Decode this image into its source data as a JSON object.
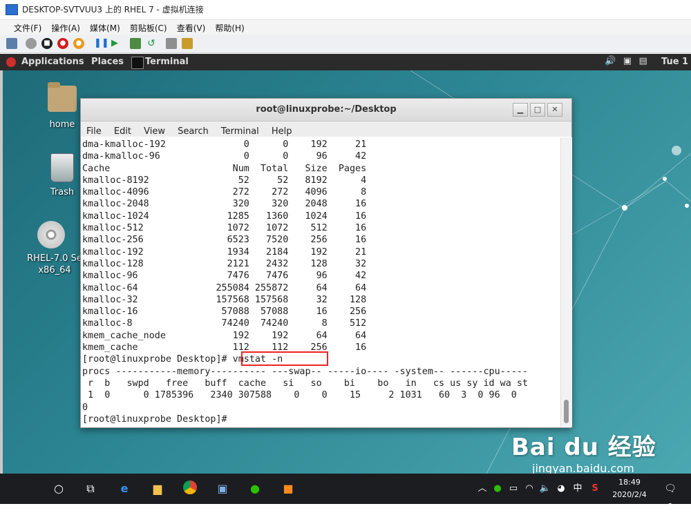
{
  "host_window": {
    "title": "DESKTOP-SVTVUU3 上的 RHEL 7 - 虚拟机连接",
    "menu": [
      "文件(F)",
      "操作(A)",
      "媒体(M)",
      "剪贴板(C)",
      "查看(V)",
      "帮助(H)"
    ]
  },
  "gnome_bar": {
    "applications": "Applications",
    "places": "Places",
    "active_app": "Terminal",
    "clock": "Tue 1"
  },
  "desktop_icons": [
    {
      "label": "home"
    },
    {
      "label": "Trash"
    },
    {
      "label": "RHEL-7.0 Se x86_64"
    }
  ],
  "terminal": {
    "title": "root@linuxprobe:~/Desktop",
    "menu": [
      "File",
      "Edit",
      "View",
      "Search",
      "Terminal",
      "Help"
    ],
    "lines": [
      "dma-kmalloc-192              0      0    192     21",
      "dma-kmalloc-96               0      0     96     42",
      "Cache                      Num  Total   Size  Pages",
      "kmalloc-8192                52     52   8192      4",
      "kmalloc-4096               272    272   4096      8",
      "kmalloc-2048               320    320   2048     16",
      "kmalloc-1024              1285   1360   1024     16",
      "kmalloc-512               1072   1072    512     16",
      "kmalloc-256               6523   7520    256     16",
      "kmalloc-192               1934   2184    192     21",
      "kmalloc-128               2121   2432    128     32",
      "kmalloc-96                7476   7476     96     42",
      "kmalloc-64              255084 255872     64     64",
      "kmalloc-32              157568 157568     32    128",
      "kmalloc-16               57088  57088     16    256",
      "kmalloc-8                74240  74240      8    512",
      "kmem_cache_node            192    192     64     64",
      "kmem_cache                 112    112    256     16",
      "[root@linuxprobe Desktop]# vmstat -n",
      "procs -----------memory---------- ---swap-- -----io---- -system-- ------cpu-----",
      " r  b   swpd   free   buff  cache   si   so    bi    bo   in   cs us sy id wa st",
      " 1  0      0 1785396   2340 307588    0    0    15     2 1031   60  3  0 96  0",
      "0",
      "[root@linuxprobe Desktop]# "
    ]
  },
  "taskbar": {
    "ime": "中",
    "time": "18:49",
    "date": "2020/2/4",
    "notifications": "2"
  },
  "watermark": {
    "brand": "Bai du 经验",
    "url": "jingyan.baidu.com"
  }
}
